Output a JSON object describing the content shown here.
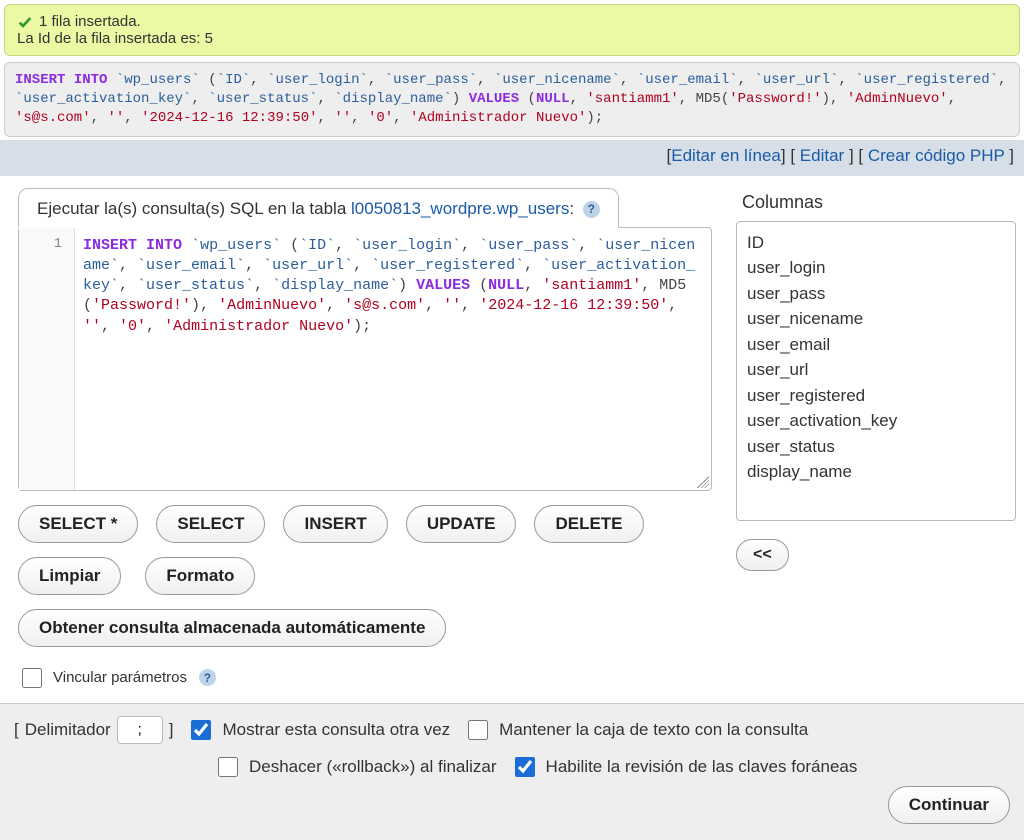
{
  "success": {
    "line1": "1 fila insertada.",
    "line2": "La Id de la fila insertada es: 5"
  },
  "sql_preview": {
    "tokens": [
      {
        "t": "kw",
        "v": "INSERT"
      },
      {
        "t": "sp"
      },
      {
        "t": "kw",
        "v": "INTO"
      },
      {
        "t": "sp"
      },
      {
        "t": "bt",
        "v": "`wp_users`"
      },
      {
        "t": "sp"
      },
      {
        "t": "p",
        "v": "("
      },
      {
        "t": "bt",
        "v": "`ID`"
      },
      {
        "t": "p",
        "v": ", "
      },
      {
        "t": "bt",
        "v": "`user_login`"
      },
      {
        "t": "p",
        "v": ", "
      },
      {
        "t": "bt",
        "v": "`user_pass`"
      },
      {
        "t": "p",
        "v": ", "
      },
      {
        "t": "bt",
        "v": "`user_nicename`"
      },
      {
        "t": "p",
        "v": ", "
      },
      {
        "t": "bt",
        "v": "`user_email`"
      },
      {
        "t": "p",
        "v": ", "
      },
      {
        "t": "bt",
        "v": "`user_url`"
      },
      {
        "t": "p",
        "v": ", "
      },
      {
        "t": "bt",
        "v": "`user_registered`"
      },
      {
        "t": "p",
        "v": ", "
      },
      {
        "t": "bt",
        "v": "`user_activation_key`"
      },
      {
        "t": "p",
        "v": ", "
      },
      {
        "t": "bt",
        "v": "`user_status`"
      },
      {
        "t": "p",
        "v": ", "
      },
      {
        "t": "bt",
        "v": "`display_name`"
      },
      {
        "t": "p",
        "v": ") "
      },
      {
        "t": "kw",
        "v": "VALUES"
      },
      {
        "t": "sp"
      },
      {
        "t": "p",
        "v": "("
      },
      {
        "t": "kw",
        "v": "NULL"
      },
      {
        "t": "p",
        "v": ", "
      },
      {
        "t": "str",
        "v": "'santiamm1'"
      },
      {
        "t": "p",
        "v": ", "
      },
      {
        "t": "fn",
        "v": "MD5("
      },
      {
        "t": "str",
        "v": "'Password!'"
      },
      {
        "t": "fn",
        "v": ")"
      },
      {
        "t": "p",
        "v": ", "
      },
      {
        "t": "str",
        "v": "'AdminNuevo'"
      },
      {
        "t": "p",
        "v": ", "
      },
      {
        "t": "str",
        "v": "'s@s.com'"
      },
      {
        "t": "p",
        "v": ", "
      },
      {
        "t": "str",
        "v": "''"
      },
      {
        "t": "p",
        "v": ", "
      },
      {
        "t": "str",
        "v": "'2024-12-16 12:39:50'"
      },
      {
        "t": "p",
        "v": ", "
      },
      {
        "t": "str",
        "v": "''"
      },
      {
        "t": "p",
        "v": ", "
      },
      {
        "t": "str",
        "v": "'0'"
      },
      {
        "t": "p",
        "v": ", "
      },
      {
        "t": "str",
        "v": "'Administrador Nuevo'"
      },
      {
        "t": "p",
        "v": ");"
      }
    ]
  },
  "links": {
    "edit_inline": "Editar en línea",
    "edit": "Editar",
    "create_php": "Crear código PHP"
  },
  "query_box": {
    "label_prefix": "Ejecutar la(s) consulta(s) SQL en la tabla ",
    "db_table": "l0050813_wordpre.wp_users",
    "label_suffix": ":"
  },
  "editor": {
    "line_numbers": [
      "1"
    ],
    "tokens": [
      {
        "t": "kw",
        "v": "INSERT"
      },
      {
        "t": "sp"
      },
      {
        "t": "kw",
        "v": "INTO"
      },
      {
        "t": "sp"
      },
      {
        "t": "bt",
        "v": "`wp_users`"
      },
      {
        "t": "sp"
      },
      {
        "t": "p",
        "v": "("
      },
      {
        "t": "bt",
        "v": "`ID`"
      },
      {
        "t": "p",
        "v": ", "
      },
      {
        "t": "bt",
        "v": "`user_login`"
      },
      {
        "t": "p",
        "v": ", "
      },
      {
        "t": "bt",
        "v": "`user_pass`"
      },
      {
        "t": "p",
        "v": ", "
      },
      {
        "t": "bt",
        "v": "`user_nicename`"
      },
      {
        "t": "p",
        "v": ", "
      },
      {
        "t": "bt",
        "v": "`user_email`"
      },
      {
        "t": "p",
        "v": ", "
      },
      {
        "t": "bt",
        "v": "`user_url`"
      },
      {
        "t": "p",
        "v": ", "
      },
      {
        "t": "bt",
        "v": "`user_registered`"
      },
      {
        "t": "p",
        "v": ", "
      },
      {
        "t": "bt",
        "v": "`user_activation_key`"
      },
      {
        "t": "p",
        "v": ", "
      },
      {
        "t": "bt",
        "v": "`user_status`"
      },
      {
        "t": "p",
        "v": ", "
      },
      {
        "t": "bt",
        "v": "`display_name`"
      },
      {
        "t": "p",
        "v": ") "
      },
      {
        "t": "kw",
        "v": "VALUES"
      },
      {
        "t": "sp"
      },
      {
        "t": "p",
        "v": "("
      },
      {
        "t": "kw",
        "v": "NULL"
      },
      {
        "t": "p",
        "v": ", "
      },
      {
        "t": "str",
        "v": "'santiamm1'"
      },
      {
        "t": "p",
        "v": ", "
      },
      {
        "t": "fn",
        "v": "MD5("
      },
      {
        "t": "str",
        "v": "'Password!'"
      },
      {
        "t": "fn",
        "v": ")"
      },
      {
        "t": "p",
        "v": ", "
      },
      {
        "t": "str",
        "v": "'AdminNuevo'"
      },
      {
        "t": "p",
        "v": ", "
      },
      {
        "t": "str",
        "v": "'s@s.com'"
      },
      {
        "t": "p",
        "v": ", "
      },
      {
        "t": "str",
        "v": "''"
      },
      {
        "t": "p",
        "v": ", "
      },
      {
        "t": "str",
        "v": "'2024-12-16 12:39:50'"
      },
      {
        "t": "p",
        "v": ", "
      },
      {
        "t": "str",
        "v": "''"
      },
      {
        "t": "p",
        "v": ", "
      },
      {
        "t": "str",
        "v": "'0'"
      },
      {
        "t": "p",
        "v": ", "
      },
      {
        "t": "str",
        "v": "'Administrador Nuevo'"
      },
      {
        "t": "p",
        "v": ");"
      }
    ]
  },
  "buttons": {
    "select_star": "SELECT *",
    "select": "SELECT",
    "insert": "INSERT",
    "update": "UPDATE",
    "delete": "DELETE",
    "clear": "Limpiar",
    "format": "Formato",
    "autosaved": "Obtener consulta almacenada automáticamente",
    "cols_prev": "<<",
    "continue": "Continuar"
  },
  "bind": {
    "label": "Vincular parámetros",
    "checked": false
  },
  "columns": {
    "header": "Columnas",
    "items": [
      "ID",
      "user_login",
      "user_pass",
      "user_nicename",
      "user_email",
      "user_url",
      "user_registered",
      "user_activation_key",
      "user_status",
      "display_name"
    ]
  },
  "footer": {
    "delim_label": "Delimitador",
    "delim_value": ";",
    "show_again": {
      "label": "Mostrar esta consulta otra vez",
      "checked": true
    },
    "retain_box": {
      "label": "Mantener la caja de texto con la consulta",
      "checked": false
    },
    "rollback": {
      "label": "Deshacer («rollback») al finalizar",
      "checked": false
    },
    "fk_check": {
      "label": "Habilite la revisión de las claves foráneas",
      "checked": true
    }
  }
}
